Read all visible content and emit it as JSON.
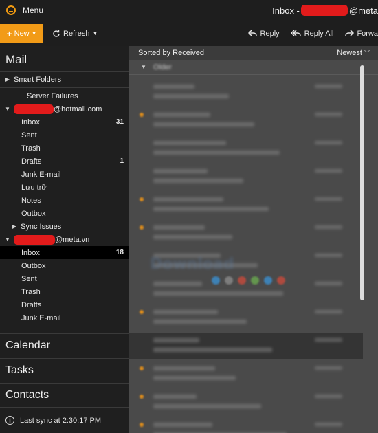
{
  "titlebar": {
    "menu_label": "Menu",
    "window_title_prefix": "Inbox - ",
    "window_title_suffix": "@meta"
  },
  "toolbar": {
    "new_label": "New",
    "refresh_label": "Refresh",
    "reply_label": "Reply",
    "reply_all_label": "Reply All",
    "forward_label": "Forwa"
  },
  "sidebar": {
    "mail_header": "Mail",
    "smart_folders": "Smart Folders",
    "server_failures": "Server Failures",
    "account1": {
      "suffix": "@hotmail.com",
      "folders": [
        {
          "label": "Inbox",
          "count": "31"
        },
        {
          "label": "Sent",
          "count": ""
        },
        {
          "label": "Trash",
          "count": ""
        },
        {
          "label": "Drafts",
          "count": "1"
        },
        {
          "label": "Junk E-mail",
          "count": ""
        },
        {
          "label": "Lưu trữ",
          "count": ""
        },
        {
          "label": "Notes",
          "count": ""
        },
        {
          "label": "Outbox",
          "count": ""
        }
      ],
      "sync_issues": "Sync Issues"
    },
    "account2": {
      "suffix": "@meta.vn",
      "folders": [
        {
          "label": "Inbox",
          "count": "18"
        },
        {
          "label": "Outbox",
          "count": ""
        },
        {
          "label": "Sent",
          "count": ""
        },
        {
          "label": "Trash",
          "count": ""
        },
        {
          "label": "Drafts",
          "count": ""
        },
        {
          "label": "Junk E-mail",
          "count": ""
        }
      ]
    },
    "calendar": "Calendar",
    "tasks": "Tasks",
    "contacts": "Contacts",
    "last_sync": "Last sync at 2:30:17 PM"
  },
  "list": {
    "sorted_by": "Sorted by Received",
    "order": "Newest",
    "group_label": "Older"
  },
  "colors": {
    "accent": "#f29b17",
    "redaction": "#e21b1b",
    "selected_bg": "#000000"
  }
}
